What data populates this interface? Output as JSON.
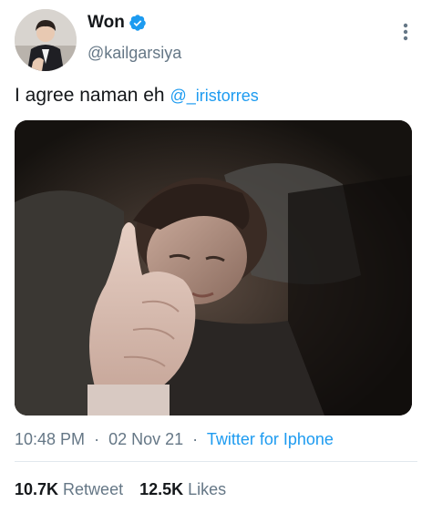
{
  "tweet": {
    "author": {
      "display_name": "Won",
      "handle": "@kailgarsiya",
      "verified": true,
      "avatar_icon": "user-avatar"
    },
    "text": "I agree naman eh",
    "mention": "@_iristorres",
    "media_description_icon": "photo-icon",
    "time": "10:48 PM",
    "date": "02 Nov 21",
    "source": "Twitter for Iphone",
    "separator": "·",
    "stats": {
      "retweets_count": "10.7K",
      "retweets_label": "Retweet",
      "likes_count": "12.5K",
      "likes_label": "Likes"
    }
  },
  "colors": {
    "accent": "#1d9bf0",
    "text_primary": "#14171a",
    "text_secondary": "#657786",
    "divider": "#e1e8ed"
  }
}
